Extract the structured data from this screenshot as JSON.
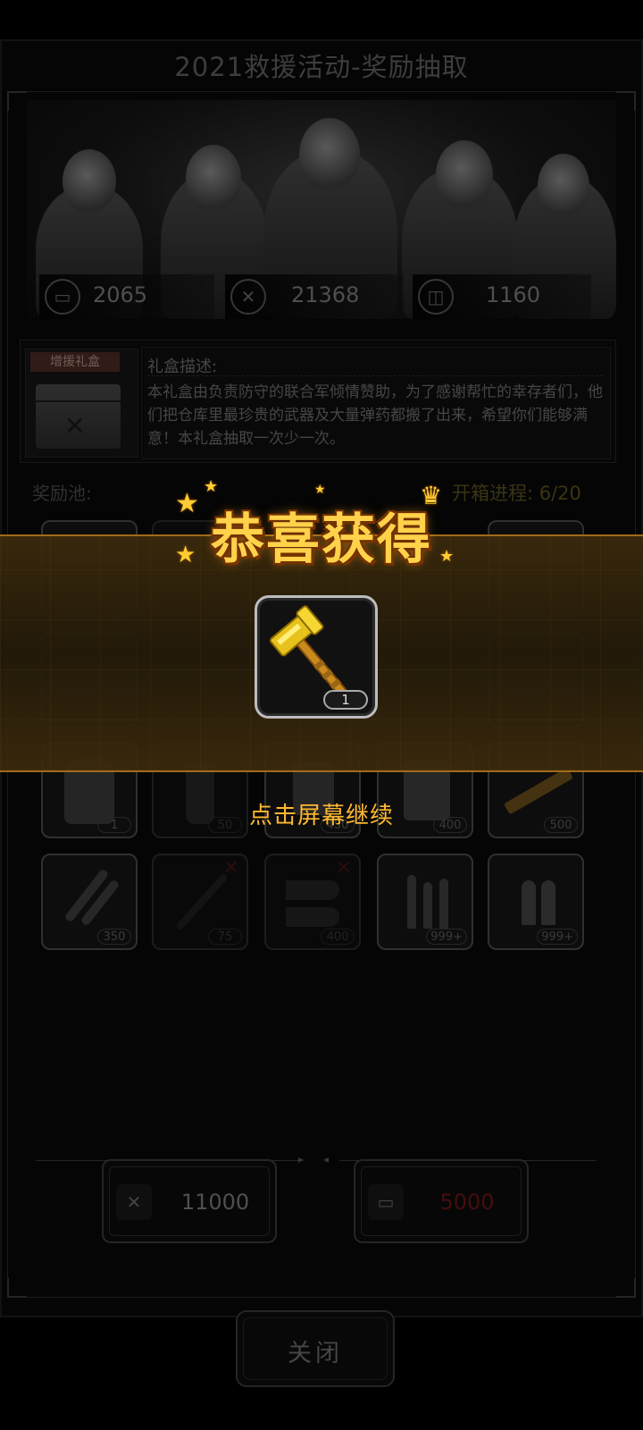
{
  "header": {
    "title": "2021救援活动-奖励抽取"
  },
  "currencies": [
    {
      "icon": "card-icon",
      "value": "2065"
    },
    {
      "icon": "badge-icon",
      "value": "21368"
    },
    {
      "icon": "vehicle-icon",
      "value": "1160"
    }
  ],
  "gift_box": {
    "banner": "增援礼盒",
    "description_label": "礼盒描述:",
    "description": "本礼盒由负责防守的联合军倾情赞助，为了感谢帮忙的幸存者们，他们把仓库里最珍贵的武器及大量弹药都搬了出来，希望你们能够满意！本礼盒抽取一次少一次。"
  },
  "reward_pool": {
    "label": "奖励池:",
    "progress": "开箱进程: 6/20",
    "row3": [
      {
        "item": "riot-shield-icon",
        "qty": "1"
      },
      {
        "item": "grenade-icon",
        "qty": "50",
        "taken": true
      },
      {
        "item": "explosive-icon",
        "qty": "450"
      },
      {
        "item": "fuel-can-icon",
        "qty": "400"
      },
      {
        "item": "rifle-icon",
        "qty": "500"
      }
    ],
    "row4": [
      {
        "item": "rifle-ammo-icon",
        "qty": "350"
      },
      {
        "item": "rocket-icon",
        "qty": "75",
        "taken": true
      },
      {
        "item": "shell-icon",
        "qty": "400",
        "taken": true
      },
      {
        "item": "bullets-icon",
        "qty": "999+"
      },
      {
        "item": "pistol-ammo-icon",
        "qty": "999+"
      }
    ]
  },
  "draw_buttons": [
    {
      "icon": "badge-icon",
      "value": "11000",
      "color": "#7a7a7a"
    },
    {
      "icon": "card-icon",
      "value": "5000",
      "color": "#6a1414"
    }
  ],
  "close_button": {
    "label": "关闭"
  },
  "overlay": {
    "title": "恭喜获得",
    "reward_item": "golden-hammer-icon",
    "reward_qty": "1",
    "hint": "点击屏幕继续",
    "accent": "#ffd24a"
  }
}
